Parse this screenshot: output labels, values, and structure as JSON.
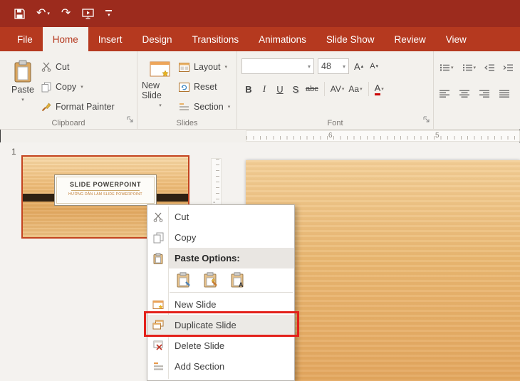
{
  "titlebar": {
    "icons": [
      "save-icon",
      "undo-icon",
      "redo-icon",
      "start-slideshow-icon",
      "customize-qat-icon"
    ]
  },
  "tabs": {
    "active": "Home",
    "items": [
      {
        "label": "File"
      },
      {
        "label": "Home"
      },
      {
        "label": "Insert"
      },
      {
        "label": "Design"
      },
      {
        "label": "Transitions"
      },
      {
        "label": "Animations"
      },
      {
        "label": "Slide Show"
      },
      {
        "label": "Review"
      },
      {
        "label": "View"
      }
    ]
  },
  "ribbon": {
    "clipboard": {
      "group_label": "Clipboard",
      "paste": "Paste",
      "cut": "Cut",
      "copy": "Copy",
      "format_painter": "Format Painter"
    },
    "slides": {
      "group_label": "Slides",
      "new_slide": "New Slide",
      "layout": "Layout",
      "reset": "Reset",
      "section": "Section"
    },
    "font": {
      "group_label": "Font",
      "font_name_value": "",
      "font_size_value": "48",
      "bold": "B",
      "italic": "I",
      "underline": "U",
      "shadow": "S",
      "strikethrough": "abc",
      "char_spacing": "AV",
      "change_case": "Aa",
      "font_color": "A"
    }
  },
  "ruler": {
    "marks": [
      "6",
      "5"
    ]
  },
  "thumbnail_pane": {
    "slide_number": "1",
    "slide_title": "SLIDE POWERPOINT",
    "slide_subtitle": "HƯỚNG DẪN LÀM SLIDE POWERPOINT"
  },
  "context_menu": {
    "items": [
      {
        "label": "Cut"
      },
      {
        "label": "Copy"
      },
      {
        "label": "Paste Options:"
      },
      {
        "label": "New Slide"
      },
      {
        "label": "Duplicate Slide"
      },
      {
        "label": "Delete Slide"
      },
      {
        "label": "Add Section"
      }
    ],
    "paste_option_icons": [
      "paste-use-destination-theme-icon",
      "paste-keep-source-formatting-icon",
      "paste-keep-text-only-icon"
    ]
  },
  "colors": {
    "titlebar_red": "#9c2b1d",
    "ribbon_red": "#b5391f",
    "annotation_red": "#e3211b"
  }
}
